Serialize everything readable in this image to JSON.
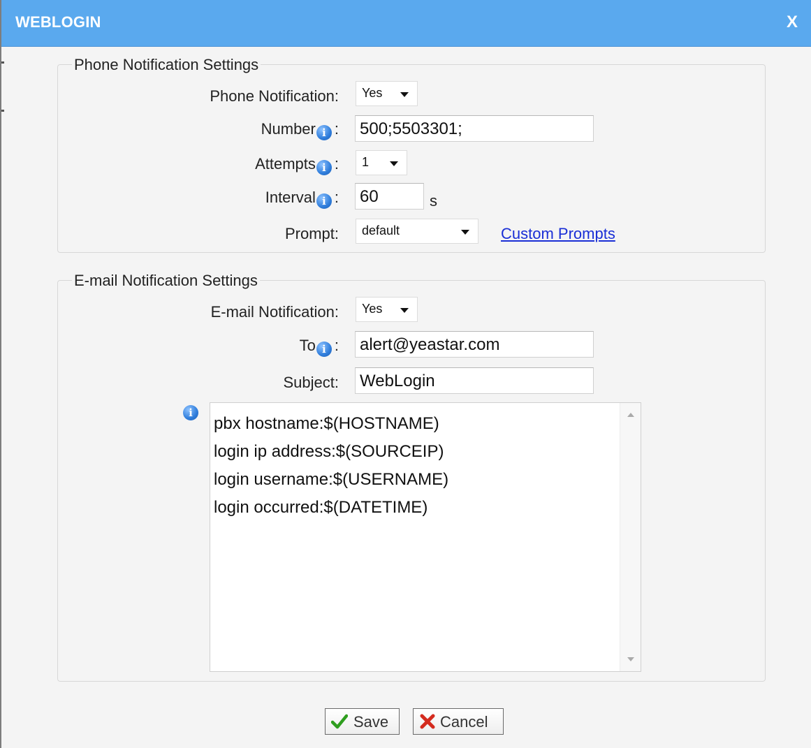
{
  "dialog": {
    "title": "WEBLOGIN",
    "close_label": "X"
  },
  "phone": {
    "legend": "Phone Notification Settings",
    "notification_label": "Phone Notification:",
    "notification_value": "Yes",
    "number_label": "Number",
    "number_value": "500;5503301;",
    "attempts_label": "Attempts",
    "attempts_value": "1",
    "interval_label": "Interval",
    "interval_value": "60",
    "interval_unit": "s",
    "prompt_label": "Prompt:",
    "prompt_value": "default",
    "custom_prompts_link": "Custom Prompts"
  },
  "email": {
    "legend": "E-mail Notification Settings",
    "notification_label": "E-mail Notification:",
    "notification_value": "Yes",
    "to_label": "To",
    "to_value": "alert@yeastar.com",
    "subject_label": "Subject:",
    "subject_value": "WebLogin",
    "body_lines": [
      "pbx hostname:$(HOSTNAME)",
      "login ip address:$(SOURCEIP)",
      "login username:$(USERNAME)",
      "login occurred:$(DATETIME)"
    ]
  },
  "common": {
    "colon": ":",
    "info_glyph": "i"
  },
  "actions": {
    "save_label": "Save",
    "cancel_label": "Cancel"
  }
}
